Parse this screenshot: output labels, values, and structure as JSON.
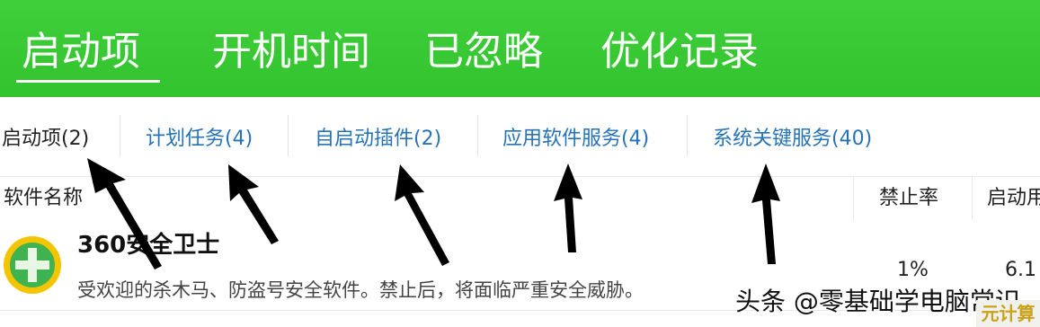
{
  "top_tabs": [
    {
      "label": "启动项",
      "active": true
    },
    {
      "label": "开机时间",
      "active": false
    },
    {
      "label": "已忽略",
      "active": false
    },
    {
      "label": "优化记录",
      "active": false
    }
  ],
  "sub_tabs": [
    {
      "label": "启动项(2)",
      "active": true
    },
    {
      "label": "计划任务(4)",
      "active": false
    },
    {
      "label": "自启动插件(2)",
      "active": false
    },
    {
      "label": "应用软件服务(4)",
      "active": false
    },
    {
      "label": "系统关键服务(40)",
      "active": false
    }
  ],
  "table": {
    "columns": [
      "软件名称",
      "禁止率",
      "启动用"
    ],
    "rows": [
      {
        "name": "360安全卫士",
        "description": "受欢迎的杀木马、防盗号安全软件。禁止后，将面临严重安全威胁。",
        "disable_rate": "1%",
        "startup_time": "6.1"
      }
    ]
  },
  "watermark": {
    "text": "头条 @零基础学电脑常识",
    "logo_text": "元计算"
  },
  "colors": {
    "accent_green": "#35c631",
    "link_blue": "#2673b7",
    "icon_yellow": "#f2c500",
    "icon_green": "#3fb34f",
    "arrow": "#000000"
  }
}
